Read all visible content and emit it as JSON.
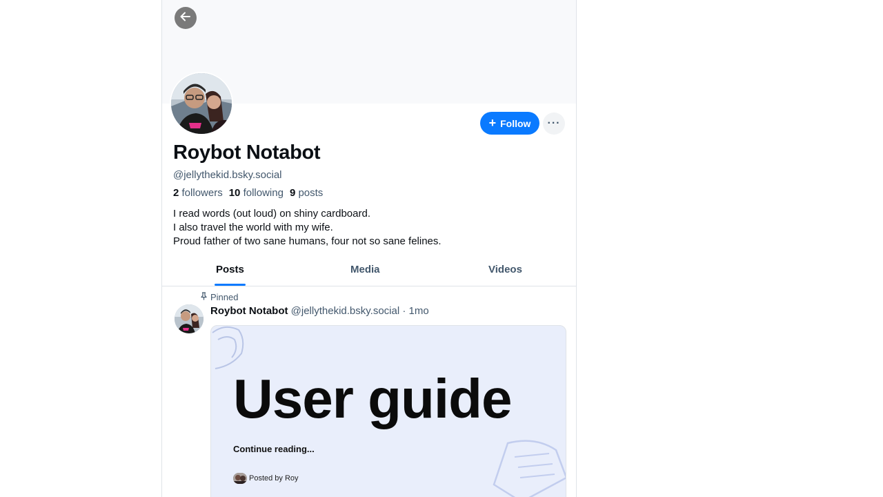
{
  "profile": {
    "display_name": "Roybot Notabot",
    "handle": "@jellythekid.bsky.social",
    "followers_count": "2",
    "followers_label": "followers",
    "following_count": "10",
    "following_label": "following",
    "posts_count": "9",
    "posts_label": "posts",
    "bio": [
      "I read words (out loud) on shiny cardboard.",
      "I also travel the world with my wife.",
      "Proud father of two sane humans, four not so sane felines."
    ],
    "follow_label": "Follow",
    "more_label": "···"
  },
  "tabs": [
    {
      "label": "Posts",
      "active": true
    },
    {
      "label": "Media",
      "active": false
    },
    {
      "label": "Videos",
      "active": false
    }
  ],
  "post": {
    "pinned_label": "Pinned",
    "author": "Roybot Notabot",
    "handle": "@jellythekid.bsky.social",
    "separator": "·",
    "time": "1mo",
    "card": {
      "title": "User guide",
      "continue": "Continue reading...",
      "posted_by": "Posted by Roy"
    }
  },
  "colors": {
    "accent": "#0a7aff",
    "muted_text": "#42576c",
    "card_bg": "#e9eefb"
  },
  "icons": {
    "back": "arrow-left-icon",
    "follow": "plus-icon",
    "more": "ellipsis-icon",
    "pinned": "pin-icon"
  }
}
